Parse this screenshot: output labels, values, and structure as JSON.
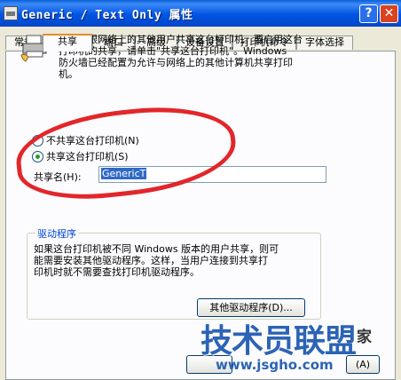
{
  "window": {
    "title": "Generic / Text Only 属性",
    "help_label": "?",
    "close_label": "✕"
  },
  "tabs": [
    {
      "label": "常规"
    },
    {
      "label": "共享"
    },
    {
      "label": "端口"
    },
    {
      "label": "高级"
    },
    {
      "label": "设备设置"
    },
    {
      "label": "打印机命令"
    },
    {
      "label": "字体选择"
    }
  ],
  "share_panel": {
    "description_lines": [
      "您可以跟网络上的其他用户共享这台打印机。要启用这台",
      "打印机的共享，请单击\"共享这台打印机\"。Windows",
      "防火墙已经配置为允许与网络上的其他计算机共享打印",
      "机。"
    ],
    "radio_not_share": "不共享这台打印机(N)",
    "radio_share": "共享这台打印机(S)",
    "selected_option": "share",
    "share_name_label": "共享名(H):",
    "share_name_value": "GenericT"
  },
  "drivers": {
    "group_title": "驱动程序",
    "text_lines": [
      "如果这台打印机被不同 Windows 版本的用户共享，则可",
      "能需要安装其他驱动程序。这样，当用户连接到共享打",
      "印机时就不需要查找打印机驱动程序。"
    ],
    "other_drivers_button": "其他驱动程序(D)..."
  },
  "footer": {
    "apply_button": "(A)"
  },
  "watermark": {
    "main": "技术员联盟",
    "url": "www.jsgho.com",
    "corner": "家"
  },
  "colors": {
    "title_bar": "#0054e3",
    "annotation": "#e2262a",
    "watermark": "#2c63b5"
  }
}
